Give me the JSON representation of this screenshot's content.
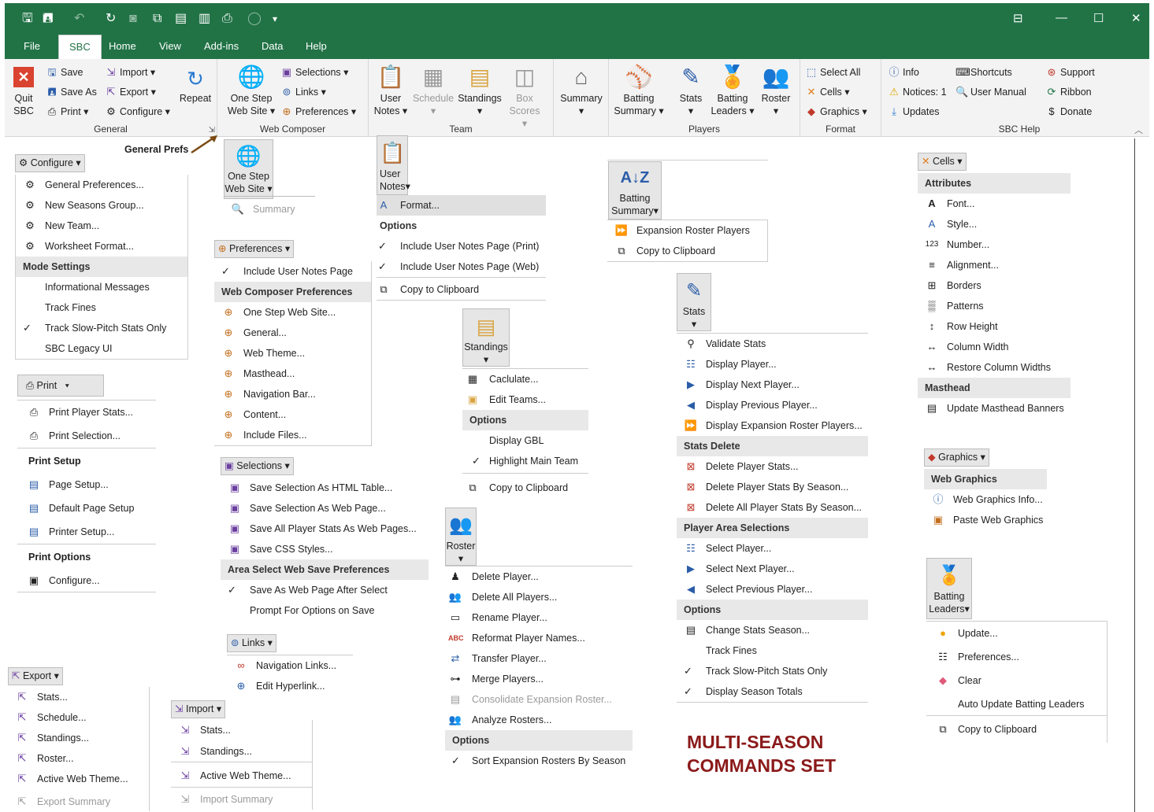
{
  "ribbon_tabs": [
    "File",
    "SBC",
    "Home",
    "View",
    "Add-ins",
    "Data",
    "Help"
  ],
  "ribbon": {
    "quit": "Quit SBC",
    "save": "Save",
    "save_as": "Save As",
    "print": "Print",
    "import": "Import",
    "export": "Export",
    "configure": "Configure",
    "repeat": "Repeat",
    "general": "General",
    "one_step_1": "One Step",
    "one_step_2": "Web Site",
    "selections": "Selections",
    "links": "Links",
    "preferences": "Preferences",
    "web_composer": "Web Composer",
    "user_notes_1": "User",
    "user_notes_2": "Notes",
    "schedule": "Schedule",
    "standings": "Standings",
    "box_1": "Box",
    "box_2": "Scores",
    "team": "Team",
    "summary": "Summary",
    "batting_summary_1": "Batting",
    "batting_summary_2": "Summary",
    "stats": "Stats",
    "batting_leaders_1": "Batting",
    "batting_leaders_2": "Leaders",
    "roster": "Roster",
    "players": "Players",
    "select_all": "Select All",
    "cells": "Cells",
    "graphics": "Graphics",
    "format": "Format",
    "info": "Info",
    "notices": "Notices: 1",
    "updates": "Updates",
    "shortcuts": "Shortcuts",
    "user_manual": "User Manual",
    "support": "Support",
    "ribbon": "Ribbon",
    "donate": "Donate",
    "sbc_help": "SBC Help"
  },
  "general_prefs": "General Prefs",
  "configure_panel": {
    "button": "Configure",
    "items": [
      "General Preferences...",
      "New Seasons Group...",
      "New Team...",
      "Worksheet Format..."
    ],
    "mode_header": "Mode Settings",
    "modes": [
      "Informational Messages",
      "Track Fines",
      "Track Slow-Pitch Stats Only",
      "SBC Legacy UI"
    ]
  },
  "print_panel": {
    "button": "Print",
    "items": [
      "Print Player Stats...",
      "Print Selection..."
    ],
    "setup_header": "Print Setup",
    "setup": [
      "Page Setup...",
      "Default Page Setup",
      "Printer Setup..."
    ],
    "options_header": "Print Options",
    "options": [
      "Configure..."
    ]
  },
  "export_panel": {
    "button": "Export",
    "items": [
      "Stats...",
      "Schedule...",
      "Standings...",
      "Roster...",
      "Active Web Theme...",
      "Export Summary"
    ]
  },
  "import_panel": {
    "button": "Import",
    "items": [
      "Stats...",
      "Standings...",
      "Active Web Theme...",
      "Import Summary"
    ]
  },
  "onestep_panel": {
    "line1": "One Step",
    "line2": "Web Site",
    "summary": "Summary"
  },
  "preferences_panel": {
    "button": "Preferences",
    "top": "Include User Notes Page",
    "header": "Web Composer Preferences",
    "items": [
      "One Step Web Site...",
      "General...",
      "Web Theme...",
      "Masthead...",
      "Navigation Bar...",
      "Content...",
      "Include Files..."
    ]
  },
  "selections_panel": {
    "button": "Selections",
    "items": [
      "Save Selection As HTML Table...",
      "Save Selection As Web Page...",
      "Save All Player Stats As Web Pages...",
      "Save CSS Styles..."
    ],
    "header": "Area Select Web Save Preferences",
    "prefs": [
      "Save As Web Page After Select",
      "Prompt For Options on Save"
    ]
  },
  "links_panel": {
    "button": "Links",
    "items": [
      "Navigation Links...",
      "Edit Hyperlink..."
    ]
  },
  "usernotes_panel": {
    "line1": "User",
    "line2": "Notes",
    "format": "Format...",
    "header": "Options",
    "items": [
      "Include User Notes Page (Print)",
      "Include User Notes Page (Web)"
    ],
    "copy": "Copy to Clipboard"
  },
  "standings_panel": {
    "button": "Standings",
    "items": [
      "Caclulate...",
      "Edit Teams..."
    ],
    "header": "Options",
    "options": [
      "Display GBL",
      "Highlight Main Team"
    ],
    "copy": "Copy to Clipboard"
  },
  "roster_panel": {
    "button": "Roster",
    "items": [
      "Delete Player...",
      "Delete All Players...",
      "Rename Player...",
      "Reformat Player Names...",
      "Transfer Player...",
      "Merge Players...",
      "Consolidate Expansion Roster...",
      "Analyze Rosters..."
    ],
    "header": "Options",
    "options": [
      "Sort Expansion Rosters By Season"
    ]
  },
  "battingsummary_panel": {
    "line1": "Batting",
    "line2": "Summary",
    "items": [
      "Expansion Roster Players",
      "Copy to Clipboard"
    ]
  },
  "stats_panel": {
    "button": "Stats",
    "items": [
      "Validate Stats",
      "Display Player...",
      "Display Next Player...",
      "Display Previous Player...",
      "Display Expansion Roster Players..."
    ],
    "delete_header": "Stats Delete",
    "delete": [
      "Delete Player Stats...",
      "Delete Player Stats By Season...",
      "Delete All Player Stats By Season..."
    ],
    "area_header": "Player Area Selections",
    "area": [
      "Select Player...",
      "Select Next Player...",
      "Select Previous Player..."
    ],
    "options_header": "Options",
    "options": [
      "Change Stats Season...",
      "Track Fines",
      "Track Slow-Pitch Stats Only",
      "Display Season Totals"
    ]
  },
  "cells_panel": {
    "button": "Cells",
    "attr_header": "Attributes",
    "attrs": [
      "Font...",
      "Style...",
      "Number...",
      "Alignment...",
      "Borders",
      "Patterns",
      "Row Height",
      "Column Width",
      "Restore Column Widths"
    ],
    "mast_header": "Masthead",
    "mast": [
      "Update Masthead Banners"
    ]
  },
  "graphics_panel": {
    "button": "Graphics",
    "header": "Web Graphics",
    "items": [
      "Web Graphics Info...",
      "Paste Web Graphics"
    ]
  },
  "battingleaders_panel": {
    "line1": "Batting",
    "line2": "Leaders",
    "items": [
      "Update...",
      "Preferences...",
      "Clear",
      "Auto Update Batting Leaders",
      "Copy to Clipboard"
    ]
  },
  "banner": {
    "line1": "MULTI-SEASON",
    "line2": "COMMANDS SET"
  },
  "colors": {
    "excel_green": "#217346",
    "banner": "#8b1a1a"
  }
}
